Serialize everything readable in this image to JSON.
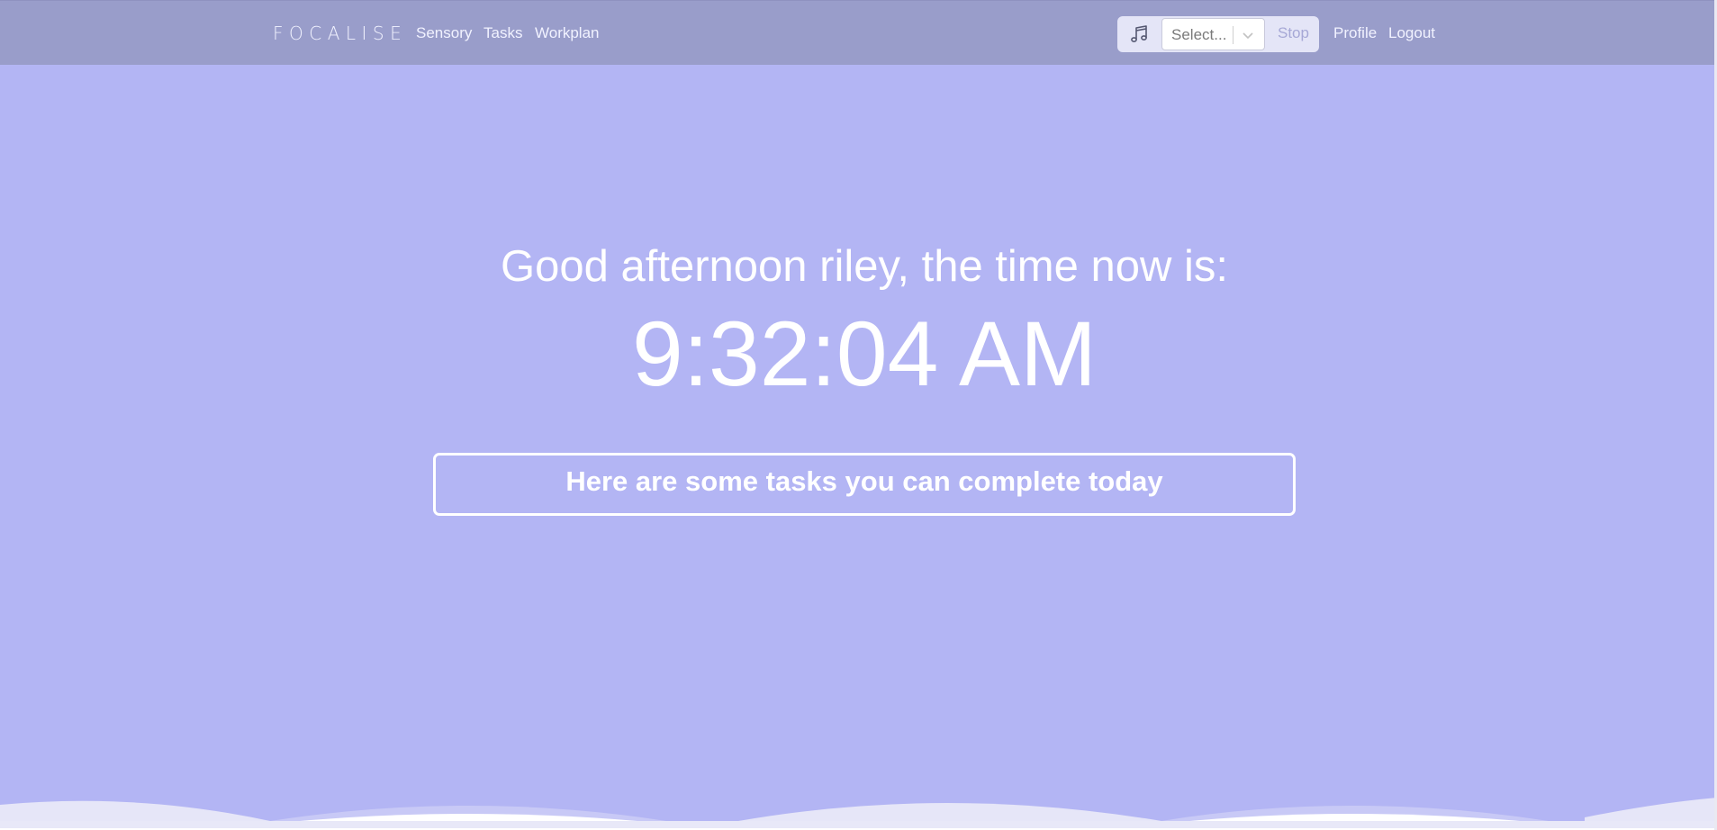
{
  "nav": {
    "brand": "FOCALISE",
    "links": {
      "sensory": "Sensory",
      "tasks": "Tasks",
      "workplan": "Workplan",
      "profile": "Profile",
      "logout": "Logout"
    },
    "music": {
      "icon": "music-note-icon",
      "select_placeholder": "Select...",
      "stop_label": "Stop"
    }
  },
  "main": {
    "greeting": "Good afternoon riley, the time now is:",
    "clock": "9:32:04 AM",
    "tasks_heading": "Here are some tasks you can complete today"
  },
  "colors": {
    "background": "#b3b5f4",
    "navbar": "#999dca",
    "text": "#ffffff"
  }
}
